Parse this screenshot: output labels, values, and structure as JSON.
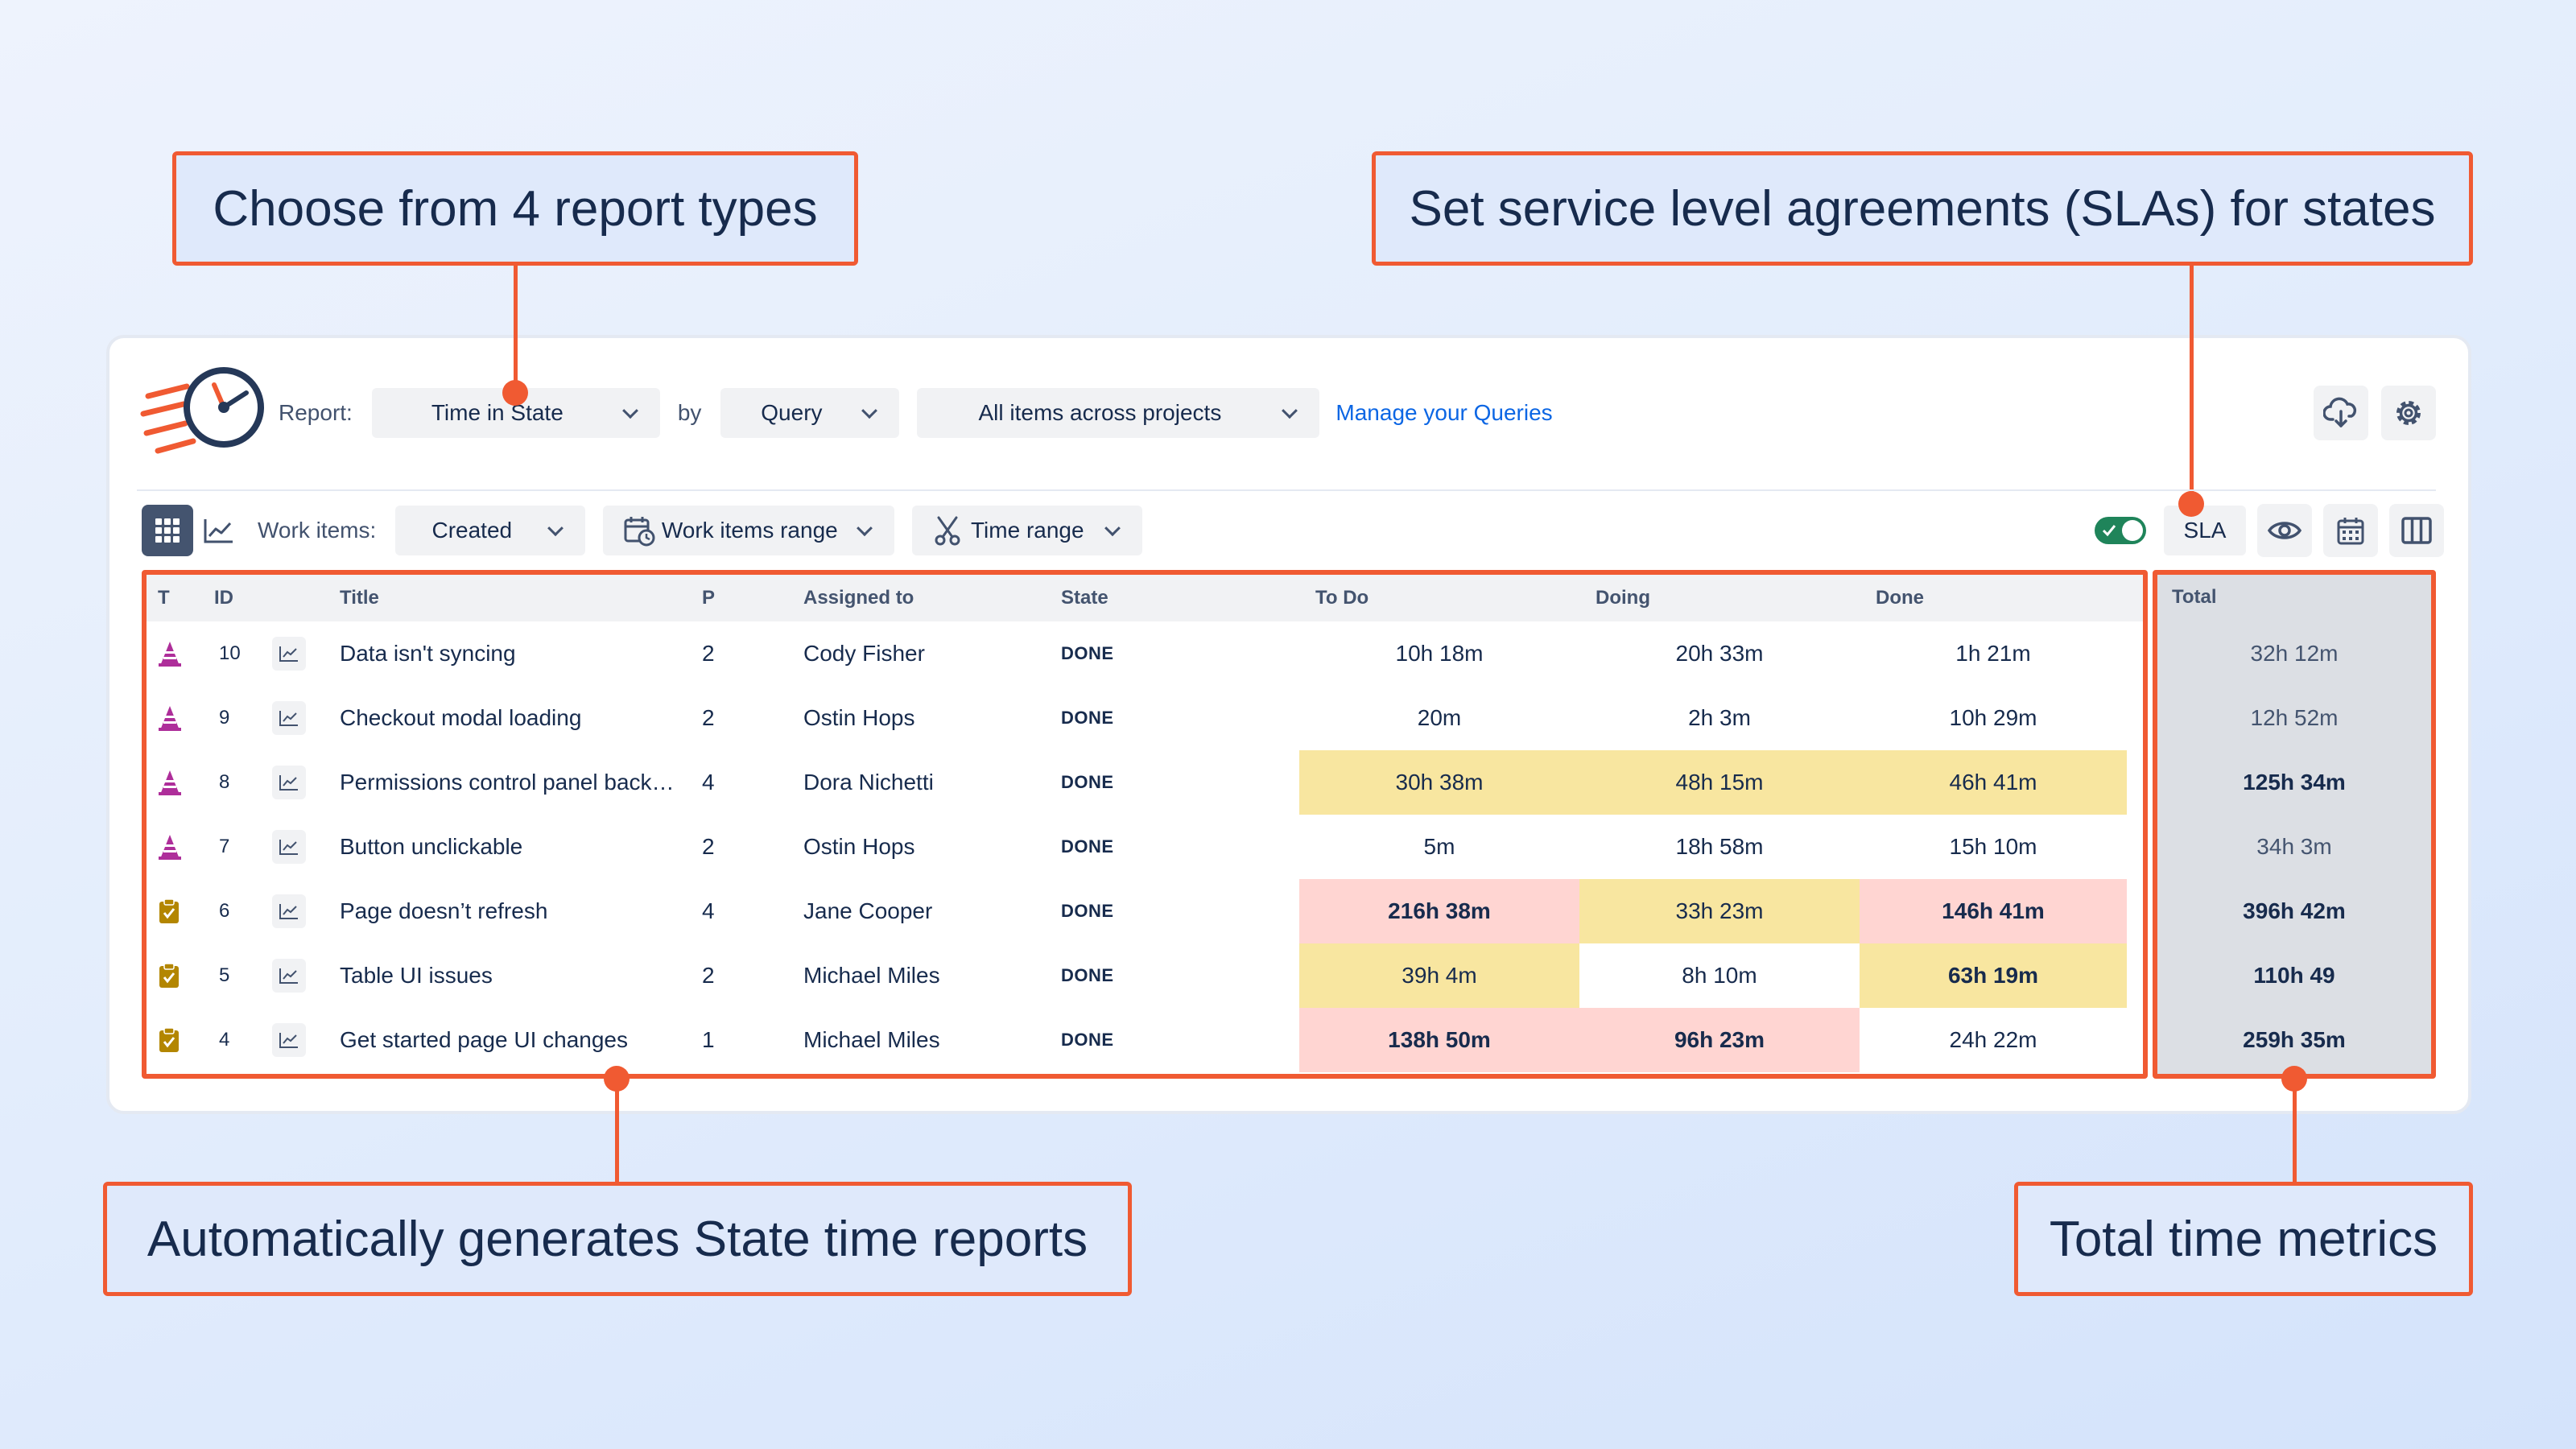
{
  "callouts": {
    "report_types": "Choose from 4 report types",
    "sla": "Set service level agreements (SLAs) for states",
    "auto_reports": "Automatically generates State time reports",
    "total_metrics": "Total time metrics"
  },
  "toolbar": {
    "report_label": "Report:",
    "report_value": "Time in State",
    "by_label": "by",
    "by_value": "Query",
    "query_value": "All items across projects",
    "manage_link": "Manage your Queries"
  },
  "filters": {
    "work_items_label": "Work items:",
    "created_value": "Created",
    "work_items_range": "Work items range",
    "time_range": "Time range",
    "sla_label": "SLA",
    "sla_enabled": true
  },
  "table": {
    "headers": {
      "t": "T",
      "id": "ID",
      "title": "Title",
      "p": "P",
      "assigned": "Assigned to",
      "state": "State",
      "todo": "To Do",
      "doing": "Doing",
      "done": "Done",
      "total": "Total"
    },
    "rows": [
      {
        "type": "bug-icon",
        "id": "10",
        "title": "Data isn't syncing",
        "p": "2",
        "assigned": "Cody Fisher",
        "state": "DONE",
        "todo": "10h 18m",
        "doing": "20h 33m",
        "done": "1h  21m",
        "total": "32h 12m",
        "todo_sla": "ok",
        "doing_sla": "ok",
        "done_sla": "ok",
        "total_bold": false
      },
      {
        "type": "bug-icon",
        "id": "9",
        "title": "Checkout modal loading",
        "p": "2",
        "assigned": "Ostin Hops",
        "state": "DONE",
        "todo": "20m",
        "doing": "2h 3m",
        "done": "10h 29m",
        "total": "12h 52m",
        "todo_sla": "ok",
        "doing_sla": "ok",
        "done_sla": "ok",
        "total_bold": false
      },
      {
        "type": "bug-icon",
        "id": "8",
        "title": "Permissions control panel back…",
        "p": "4",
        "assigned": "Dora Nichetti",
        "state": "DONE",
        "todo": "30h 38m",
        "doing": "48h 15m",
        "done": "46h 41m",
        "total": "125h 34m",
        "todo_sla": "warning",
        "doing_sla": "warning",
        "done_sla": "warning",
        "total_bold": true
      },
      {
        "type": "bug-icon",
        "id": "7",
        "title": "Button unclickable",
        "p": "2",
        "assigned": "Ostin Hops",
        "state": "DONE",
        "todo": "5m",
        "doing": "18h 58m",
        "done": "15h 10m",
        "total": "34h 3m",
        "todo_sla": "ok",
        "doing_sla": "ok",
        "done_sla": "ok",
        "total_bold": false
      },
      {
        "type": "task-icon",
        "id": "6",
        "title": "Page doesn’t refresh",
        "p": "4",
        "assigned": "Jane Cooper",
        "state": "DONE",
        "todo": "216h 38m",
        "doing": "33h 23m",
        "done": "146h 41m",
        "total": "396h 42m",
        "todo_sla": "breach",
        "doing_sla": "warning",
        "done_sla": "breach",
        "total_bold": true
      },
      {
        "type": "task-icon",
        "id": "5",
        "title": "Table UI issues",
        "p": "2",
        "assigned": "Michael Miles",
        "state": "DONE",
        "todo": "39h 4m",
        "doing": "8h 10m",
        "done": "63h 19m",
        "total": "110h 49",
        "todo_sla": "warning",
        "doing_sla": "ok",
        "done_sla": "warning-bold",
        "total_bold": true
      },
      {
        "type": "task-icon",
        "id": "4",
        "title": "Get started page UI changes",
        "p": "1",
        "assigned": "Michael Miles",
        "state": "DONE",
        "todo": "138h 50m",
        "doing": "96h 23m",
        "done": "24h 22m",
        "total": "259h 35m",
        "todo_sla": "breach",
        "doing_sla": "breach",
        "done_sla": "ok",
        "total_bold": true
      }
    ]
  },
  "colors": {
    "accent": "#f05a32",
    "warning": "#f8e6a0",
    "breach": "#ffd5d2",
    "link": "#0c66e4",
    "toggle_on": "#1f845a"
  }
}
